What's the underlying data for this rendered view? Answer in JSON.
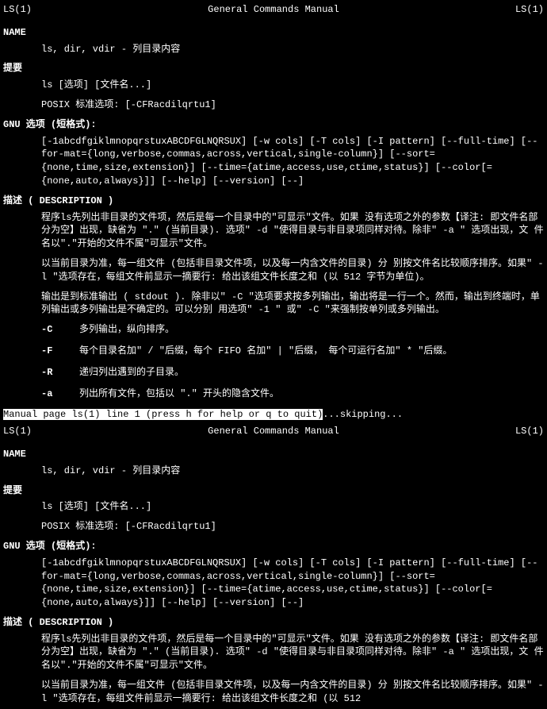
{
  "header": {
    "left": "LS(1)",
    "center": "General Commands Manual",
    "right": "LS(1)"
  },
  "sections": {
    "name": {
      "heading": "NAME",
      "content": "ls, dir, vdir - 列目录内容"
    },
    "synopsis": {
      "heading": "提要",
      "line1": "ls [选项] [文件名...]",
      "line2": "POSIX 标准选项: [-CFRacdilqrtu1]"
    },
    "gnu_options": {
      "heading": "GNU 选项 (短格式):",
      "content": "[-1abcdfgiklmnopqrstuxABCDFGLNQRSUX]  [-w cols]  [-T  cols]  [-I  pattern]  [--full-time]  [--for‐mat={long,verbose,commas,across,vertical,single-column}]      [--sort={none,time,size,extension}] [--time={atime,access,use,ctime,status}] [--color[={none,auto,always}]] [--help] [--version] [--]"
    },
    "description": {
      "heading": "描述 ( DESCRIPTION )",
      "para1": "程序ls先列出非目录的文件项，然后是每一个目录中的\"可显示\"文件。如果   没有选项之外的参数【译注: 即文件名部分为空】出现，缺省为     \".\"     (当前目录).    选项\"     -d \"使得目录与非目录项同样对待。除非\" -a \" 选项出现，文 件名以\".\"开始的文件不属\"可显示\"文件。",
      "para2": "以当前目录为准，每一组文件 (包括非目录文件项，以及每一内含文件的目录) 分  别按文件名比较顺序排序。如果\" -l \"选项存在，每组文件前显示一摘要行: 给出该组文件长度之和 (以   512 字节为单位)。",
      "para3": "输出是到标准输出 (         stdout           ). 除非以\"         -C     \"选项要求按多列输出，输出将是一行一个。然而，输出到终端时，单列输出或多列输出是不确定的。可以分别   用选项\"   -1   \"  或\"   -C \"来强制按单列或多列输出。",
      "options": [
        {
          "flag": "-C",
          "desc": "多列输出，纵向排序。"
        },
        {
          "flag": "-F",
          "desc": "每个目录名加\" / \"后缀，每个 FIFO 名加\" | \"后缀，   每个可运行名加\" * \"后缀。"
        },
        {
          "flag": "-R",
          "desc": "递归列出遇到的子目录。"
        },
        {
          "flag": "-a",
          "desc": "列出所有文件，包括以 \".\" 开头的隐含文件。"
        }
      ]
    }
  },
  "status_line": {
    "highlighted": " Manual page ls(1) line 1 (press h for help or q to quit)",
    "after": "...skipping..."
  },
  "repeat": {
    "description_para3_partial": "以当前目录为准，每一组文件 (包括非目录文件项，以及每一内含文件的目录) 分  别按文件名比较顺序排序。如果\" -l \"选项存在，每组文件前显示一摘要行: 给出该组文件长度之和 (以   512"
  }
}
